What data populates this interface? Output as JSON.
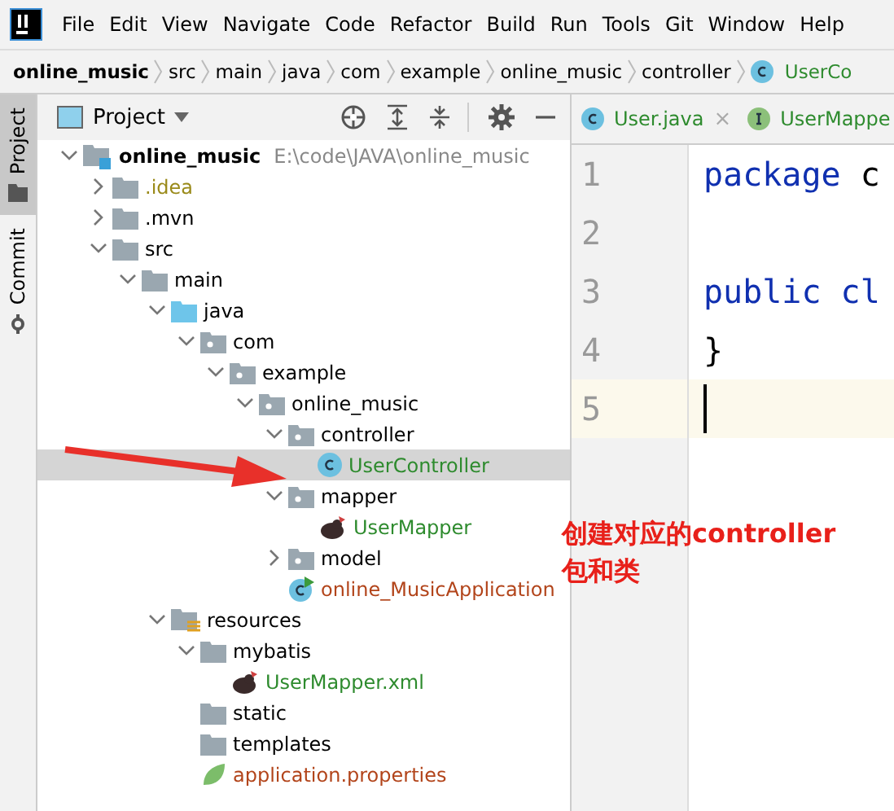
{
  "menu": [
    "File",
    "Edit",
    "View",
    "Navigate",
    "Code",
    "Refactor",
    "Build",
    "Run",
    "Tools",
    "Git",
    "Window",
    "Help"
  ],
  "breadcrumb": [
    {
      "label": "online_music",
      "kind": "project"
    },
    {
      "label": "src",
      "kind": "dir"
    },
    {
      "label": "main",
      "kind": "dir"
    },
    {
      "label": "java",
      "kind": "dir"
    },
    {
      "label": "com",
      "kind": "dir"
    },
    {
      "label": "example",
      "kind": "dir"
    },
    {
      "label": "online_music",
      "kind": "dir"
    },
    {
      "label": "controller",
      "kind": "dir"
    },
    {
      "label": "UserCo",
      "kind": "class"
    }
  ],
  "side_tabs": [
    {
      "label": "Project",
      "selected": true,
      "kind": "folder"
    },
    {
      "label": "Commit",
      "selected": false,
      "kind": "commit"
    }
  ],
  "project_panel": {
    "title": "Project",
    "tree": [
      {
        "name": "online_music",
        "path": "E:\\code\\JAVA\\online_music",
        "kind": "module",
        "expanded": true,
        "selected": false,
        "children": [
          {
            "name": ".idea",
            "kind": "folder",
            "expanded": false,
            "selected": false,
            "color": "#9a8a1a"
          },
          {
            "name": ".mvn",
            "kind": "folder",
            "expanded": false,
            "selected": false
          },
          {
            "name": "src",
            "kind": "folder",
            "expanded": true,
            "selected": false,
            "children": [
              {
                "name": "main",
                "kind": "folder",
                "expanded": true,
                "selected": false,
                "children": [
                  {
                    "name": "java",
                    "kind": "source",
                    "expanded": true,
                    "selected": false,
                    "children": [
                      {
                        "name": "com",
                        "kind": "package",
                        "expanded": true,
                        "selected": false,
                        "children": [
                          {
                            "name": "example",
                            "kind": "package",
                            "expanded": true,
                            "selected": false,
                            "children": [
                              {
                                "name": "online_music",
                                "kind": "package",
                                "expanded": true,
                                "selected": false,
                                "children": [
                                  {
                                    "name": "controller",
                                    "kind": "package",
                                    "expanded": true,
                                    "selected": false,
                                    "children": [
                                      {
                                        "name": "UserController",
                                        "kind": "class",
                                        "selected": true,
                                        "color": "#2e8b2e"
                                      }
                                    ]
                                  },
                                  {
                                    "name": "mapper",
                                    "kind": "package",
                                    "expanded": true,
                                    "selected": false,
                                    "children": [
                                      {
                                        "name": "UserMapper",
                                        "kind": "mapper",
                                        "selected": false,
                                        "color": "#2e8b2e"
                                      }
                                    ]
                                  },
                                  {
                                    "name": "model",
                                    "kind": "package",
                                    "expanded": false,
                                    "selected": false
                                  },
                                  {
                                    "name": "online_MusicApplication",
                                    "kind": "app",
                                    "selected": false,
                                    "color": "#b2441a"
                                  }
                                ]
                              }
                            ]
                          }
                        ]
                      }
                    ]
                  },
                  {
                    "name": "resources",
                    "kind": "resources",
                    "expanded": true,
                    "selected": false,
                    "children": [
                      {
                        "name": "mybatis",
                        "kind": "folder",
                        "expanded": true,
                        "selected": false,
                        "children": [
                          {
                            "name": "UserMapper.xml",
                            "kind": "mapper",
                            "selected": false,
                            "color": "#2e8b2e"
                          }
                        ]
                      },
                      {
                        "name": "static",
                        "kind": "folder",
                        "selected": false
                      },
                      {
                        "name": "templates",
                        "kind": "folder",
                        "selected": false
                      },
                      {
                        "name": "application.properties",
                        "kind": "properties",
                        "selected": false,
                        "color": "#b2441a"
                      }
                    ]
                  }
                ]
              }
            ]
          }
        ]
      }
    ]
  },
  "editor": {
    "tabs": [
      {
        "label": "User.java",
        "kind": "class",
        "selected": false,
        "close": "×"
      },
      {
        "label": "UserMappe",
        "kind": "interface",
        "selected": false
      }
    ],
    "lines": [
      {
        "number": "1",
        "current": false,
        "tokens": [
          {
            "text": "package",
            "kind": "keyword"
          },
          {
            "text": " c",
            "kind": "plain"
          }
        ]
      },
      {
        "number": "2",
        "current": false
      },
      {
        "number": "3",
        "current": false,
        "tokens": [
          {
            "text": "public",
            "kind": "keyword"
          },
          {
            "text": " cl",
            "kind": "keyword"
          }
        ]
      },
      {
        "number": "4",
        "current": false,
        "tokens": [
          {
            "text": "}",
            "kind": "plain"
          }
        ]
      },
      {
        "number": "5",
        "current": true
      }
    ]
  },
  "annotation": {
    "lines": [
      "创建对应的controller",
      "包和类"
    ]
  }
}
